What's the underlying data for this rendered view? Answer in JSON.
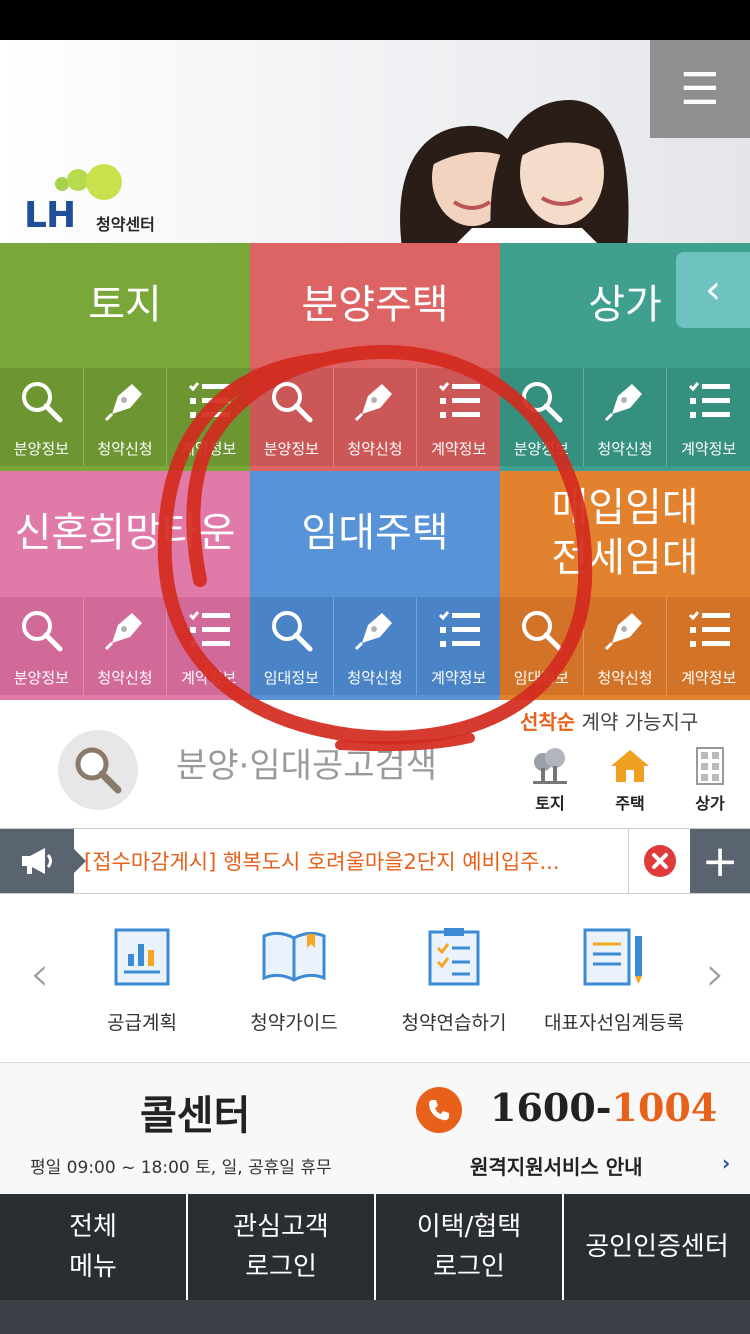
{
  "header": {
    "logo_text": "LH",
    "logo_sub": "청약센터",
    "menu_icon": "hamburger-icon"
  },
  "tiles": [
    {
      "title": "토지",
      "color": "#7aa73a",
      "sub_color": "#6d9633",
      "items": [
        {
          "label": "분양정보",
          "icon": "search-icon"
        },
        {
          "label": "청약신청",
          "icon": "pen-icon"
        },
        {
          "label": "계약정보",
          "icon": "list-icon"
        }
      ]
    },
    {
      "title": "분양주택",
      "color": "#dd6464",
      "sub_color": "#cc5757",
      "items": [
        {
          "label": "분양정보",
          "icon": "search-icon"
        },
        {
          "label": "청약신청",
          "icon": "pen-icon"
        },
        {
          "label": "계약정보",
          "icon": "list-icon"
        }
      ]
    },
    {
      "title": "상가",
      "color": "#3fa08f",
      "sub_color": "#369080",
      "items": [
        {
          "label": "분양정보",
          "icon": "search-icon"
        },
        {
          "label": "청약신청",
          "icon": "pen-icon"
        },
        {
          "label": "계약정보",
          "icon": "list-icon"
        }
      ]
    },
    {
      "title": "신혼희망타운",
      "color": "#e07aa8",
      "sub_color": "#d26a99",
      "items": [
        {
          "label": "분양정보",
          "icon": "search-icon"
        },
        {
          "label": "청약신청",
          "icon": "pen-icon"
        },
        {
          "label": "계약정보",
          "icon": "list-icon"
        }
      ]
    },
    {
      "title": "임대주택",
      "color": "#5793d6",
      "sub_color": "#4a84c6",
      "items": [
        {
          "label": "임대정보",
          "icon": "search-icon"
        },
        {
          "label": "청약신청",
          "icon": "pen-icon"
        },
        {
          "label": "계약정보",
          "icon": "list-icon"
        }
      ]
    },
    {
      "title": "매입임대\n전세임대",
      "color": "#e2812e",
      "sub_color": "#d27327",
      "items": [
        {
          "label": "임대정보",
          "icon": "search-icon"
        },
        {
          "label": "청약신청",
          "icon": "pen-icon"
        },
        {
          "label": "계약정보",
          "icon": "list-icon"
        }
      ]
    }
  ],
  "side_tab": "‹",
  "search": {
    "text": "분양·임대공고검색"
  },
  "first_come": {
    "highlight": "선착순",
    "rest": " 계약 가능지구",
    "items": [
      {
        "label": "토지",
        "icon": "tree-icon"
      },
      {
        "label": "주택",
        "icon": "house-icon"
      },
      {
        "label": "상가",
        "icon": "building-icon"
      }
    ]
  },
  "notice": {
    "text": "[접수마감게시] 행복도시 호려울마을2단지 예비입주...",
    "plus": "+"
  },
  "quick_menu": {
    "prev": "‹",
    "next": "›",
    "items": [
      {
        "label": "공급계획",
        "icon": "chart-doc-icon"
      },
      {
        "label": "청약가이드",
        "icon": "book-icon"
      },
      {
        "label": "청약연습하기",
        "icon": "checklist-icon"
      },
      {
        "label": "대표자선임계등록",
        "icon": "form-pencil-icon"
      }
    ]
  },
  "call_center": {
    "title": "콜센터",
    "number_prefix": "1600-",
    "number_suffix": "1004",
    "hours": "평일 09:00 ~ 18:00 토, 일, 공휴일 휴무",
    "remote": "원격지원서비스 안내",
    "remote_arrow": "›"
  },
  "bottom_nav": [
    {
      "label": "전체\n메뉴"
    },
    {
      "label": "관심고객\n로그인"
    },
    {
      "label": "이택/협택\n로그인"
    },
    {
      "label": "공인인증센터"
    }
  ],
  "colors": {
    "accent": "#e8611a",
    "brand": "#1f4f9b",
    "annotation": "#d42a1e"
  }
}
